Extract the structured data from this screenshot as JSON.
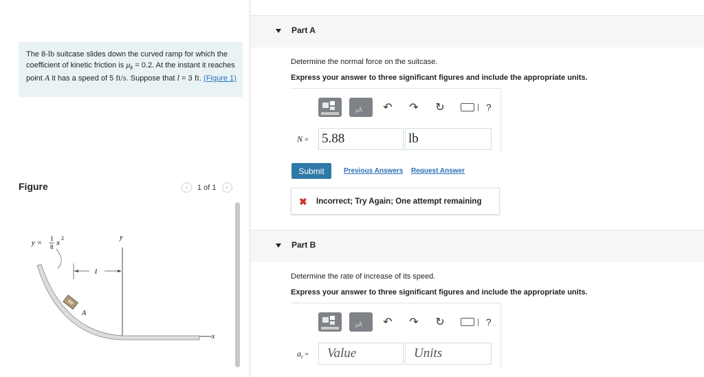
{
  "problem": {
    "text_1": "The 8-",
    "mass": "lb",
    "text_2": " suitcase slides down the curved ramp for which the coefficient of kinetic friction is ",
    "mu": "μ",
    "mu_sub": "k",
    "text_3": " = 0.2. At the instant it reaches point ",
    "point": "A",
    "text_4": " it has a speed of 5 ",
    "speed_unit": "ft/s",
    "text_5": ". Suppose that ",
    "l_var": "l",
    "text_6": " = 3 ",
    "l_unit": "ft",
    "text_7": ". ",
    "figure_link": "(Figure 1)"
  },
  "figure": {
    "title": "Figure",
    "count": "1 of 1",
    "prev_icon": "chevron-left-icon",
    "next_icon": "chevron-right-icon",
    "equation_y": "y =",
    "equation_frac_num": "1",
    "equation_frac_den": "8",
    "equation_x": "x",
    "equation_exp": "2",
    "label_l": "l",
    "label_y": "y",
    "label_x": "x",
    "label_A": "A"
  },
  "partA": {
    "label": "Part A",
    "question": "Determine the normal force on the suitcase.",
    "instruction": "Express your answer to three significant figures and include the appropriate units.",
    "var_name": "N",
    "var_eq": "=",
    "value": "5.88",
    "units": "lb",
    "submit_label": "Submit",
    "prev_answers": "Previous Answers",
    "request_answer": "Request Answer",
    "feedback": "Incorrect; Try Again; One attempt remaining",
    "feedback_icon": "x-icon"
  },
  "partB": {
    "label": "Part B",
    "question": "Determine the rate of increase of its speed.",
    "instruction": "Express your answer to three significant figures and include the appropriate units.",
    "var_name": "a",
    "var_sub": "t",
    "var_eq": "=",
    "value_placeholder": "Value",
    "units_placeholder": "Units"
  },
  "toolbar": {
    "template_icon": "templates-icon",
    "symbol_icon": "symbols-icon",
    "symbol_text": "μÅ",
    "undo_icon": "undo-icon",
    "redo_icon": "redo-icon",
    "reset_icon": "reset-icon",
    "keyboard_icon": "keyboard-icon",
    "help": "?"
  },
  "colors": {
    "accent": "#2f79a8",
    "link": "#2a6fb8",
    "error": "#d0302a",
    "problem_bg": "#e9f3f6"
  }
}
